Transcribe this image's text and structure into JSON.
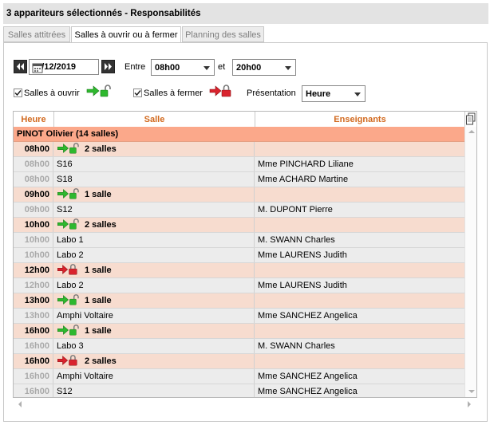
{
  "window": {
    "title": "3 appariteurs sélectionnés - Responsabilités"
  },
  "tabs": [
    {
      "label": "Salles attitrées",
      "active": false
    },
    {
      "label": "Salles à ouvrir ou à fermer",
      "active": true
    },
    {
      "label": "Planning des salles",
      "active": false
    }
  ],
  "filters": {
    "date": "02/12/2019",
    "entre_label": "Entre",
    "start_time": "08h00",
    "et_label": "et",
    "end_time": "20h00",
    "open_checkbox": {
      "label": "Salles à ouvrir",
      "checked": true
    },
    "close_checkbox": {
      "label": "Salles à fermer",
      "checked": true
    },
    "presentation_label": "Présentation",
    "presentation_value": "Heure"
  },
  "icons": {
    "prev_date": "double-chevron-left-icon",
    "next_date": "double-chevron-right-icon",
    "calendar": "calendar-icon",
    "open": "arrow-green-padlock-open-icon",
    "close": "arrow-red-padlock-closed-icon",
    "copy": "copy-icon"
  },
  "colors": {
    "header_text": "#d2691e",
    "owner_row": "#fba88a",
    "group_row": "#f7dccf",
    "detail_row": "#ececec",
    "open_green": "#2eb82e",
    "close_red": "#d9232d"
  },
  "table": {
    "columns": [
      "Heure",
      "Salle",
      "Enseignants"
    ],
    "owner": "PINOT Olivier (14 salles)",
    "rows": [
      {
        "type": "group",
        "heure": "08h00",
        "action": "open",
        "count": "2 salles"
      },
      {
        "type": "detail",
        "heure": "08h00",
        "salle": "S16",
        "enseignant": "Mme PINCHARD Liliane"
      },
      {
        "type": "detail",
        "heure": "08h00",
        "salle": "S18",
        "enseignant": "Mme ACHARD Martine"
      },
      {
        "type": "group",
        "heure": "09h00",
        "action": "open",
        "count": "1 salle"
      },
      {
        "type": "detail",
        "heure": "09h00",
        "salle": "S12",
        "enseignant": "M. DUPONT Pierre"
      },
      {
        "type": "group",
        "heure": "10h00",
        "action": "open",
        "count": "2 salles"
      },
      {
        "type": "detail",
        "heure": "10h00",
        "salle": "Labo 1",
        "enseignant": "M. SWANN Charles"
      },
      {
        "type": "detail",
        "heure": "10h00",
        "salle": "Labo 2",
        "enseignant": "Mme LAURENS Judith"
      },
      {
        "type": "group",
        "heure": "12h00",
        "action": "close",
        "count": "1 salle"
      },
      {
        "type": "detail",
        "heure": "12h00",
        "salle": "Labo 2",
        "enseignant": "Mme LAURENS Judith"
      },
      {
        "type": "group",
        "heure": "13h00",
        "action": "open",
        "count": "1 salle"
      },
      {
        "type": "detail",
        "heure": "13h00",
        "salle": "Amphi Voltaire",
        "enseignant": "Mme SANCHEZ Angelica"
      },
      {
        "type": "group",
        "heure": "16h00",
        "action": "open",
        "count": "1 salle"
      },
      {
        "type": "detail",
        "heure": "16h00",
        "salle": "Labo 3",
        "enseignant": "M. SWANN Charles"
      },
      {
        "type": "group",
        "heure": "16h00",
        "action": "close",
        "count": "2 salles"
      },
      {
        "type": "detail",
        "heure": "16h00",
        "salle": "Amphi Voltaire",
        "enseignant": "Mme SANCHEZ Angelica"
      },
      {
        "type": "detail",
        "heure": "16h00",
        "salle": "S12",
        "enseignant": "Mme SANCHEZ Angelica"
      }
    ]
  }
}
